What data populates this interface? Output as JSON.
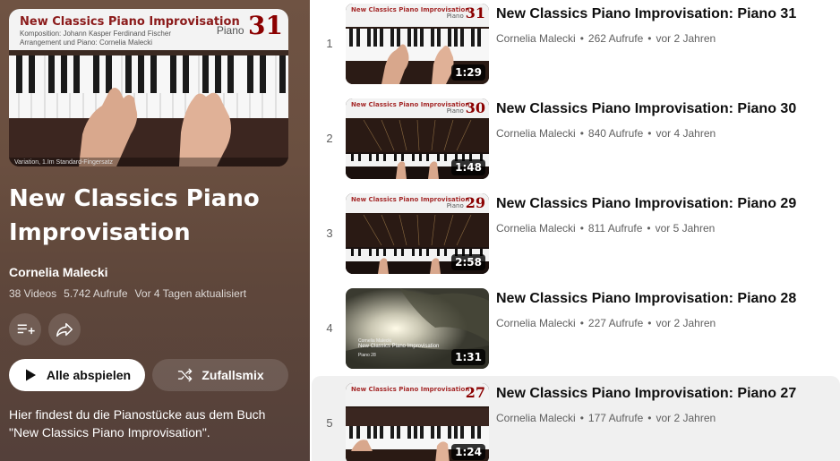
{
  "playlist": {
    "title": "New Classics Piano Improvisation",
    "owner": "Cornelia Malecki",
    "video_count": "38 Videos",
    "views": "5.742 Aufrufe",
    "updated": "Vor 4 Tagen aktualisiert",
    "play_all_label": "Alle abspielen",
    "shuffle_label": "Zufallsmix",
    "description": "Hier findest du die Pianostücke aus dem Buch \"New Classics Piano Improvisation\".",
    "thumb": {
      "title": "New Classics Piano Improvisation",
      "line1": "Komposition: Johann Kasper Ferdinand Fischer",
      "line2": "Arrangement und Piano: Cornelia Malecki",
      "piano_word": "Piano",
      "number": "31",
      "caption": "Variation, 1.Im Standard-Fingersatz"
    }
  },
  "videos": [
    {
      "index": "1",
      "title": "New Classics Piano Improvisation: Piano 31",
      "channel": "Cornelia Malecki",
      "views": "262 Aufrufe",
      "age": "vor 2 Jahren",
      "duration": "1:29",
      "num": "31",
      "style": "closeup"
    },
    {
      "index": "2",
      "title": "New Classics Piano Improvisation: Piano 30",
      "channel": "Cornelia Malecki",
      "views": "840 Aufrufe",
      "age": "vor 4 Jahren",
      "duration": "1:48",
      "num": "30",
      "style": "grand"
    },
    {
      "index": "3",
      "title": "New Classics Piano Improvisation: Piano 29",
      "channel": "Cornelia Malecki",
      "views": "811 Aufrufe",
      "age": "vor 5 Jahren",
      "duration": "2:58",
      "num": "29",
      "style": "grand"
    },
    {
      "index": "4",
      "title": "New Classics Piano Improvisation: Piano 28",
      "channel": "Cornelia Malecki",
      "views": "227 Aufrufe",
      "age": "vor 2 Jahren",
      "duration": "1:31",
      "num": "",
      "style": "forest"
    },
    {
      "index": "5",
      "title": "New Classics Piano Improvisation: Piano 27",
      "channel": "Cornelia Malecki",
      "views": "177 Aufrufe",
      "age": "vor 2 Jahren",
      "duration": "1:24",
      "num": "27",
      "style": "grand"
    }
  ],
  "thumb_text": {
    "banner": "New Classics Piano Improvisation",
    "piano_word": "Piano",
    "forest_line1": "Cornelia Malecki",
    "forest_line2": "New Classics Piano Improvisation",
    "forest_line3": "Piano 28"
  },
  "colors": {
    "panel_bg": "#6a4f40",
    "title_number": "#8b0000",
    "active_row": "#f0f0f0"
  },
  "icons": {
    "add_to_queue": "add-to-library-icon",
    "share": "share-icon",
    "play": "play-icon",
    "shuffle": "shuffle-icon"
  }
}
